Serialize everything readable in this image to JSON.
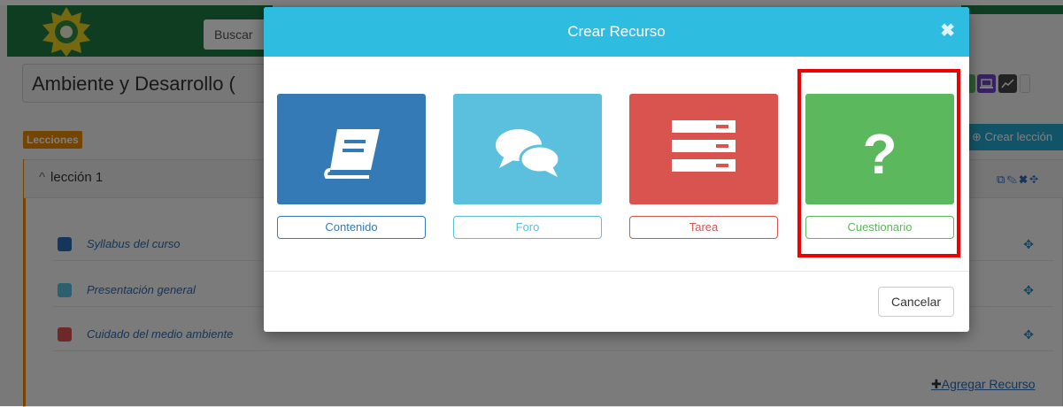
{
  "header": {
    "search_placeholder": "Buscar"
  },
  "course": {
    "title": "Ambiente y Desarrollo ("
  },
  "lessons": {
    "badge": "Lecciones",
    "create_label": "Crear lección",
    "lesson_title": "lección 1",
    "resources": [
      {
        "label": "Syllabus del curso",
        "icon": "book-icon",
        "color": "#2a6ab5"
      },
      {
        "label": "Presentación general",
        "icon": "chat-icon",
        "color": "#5bc0de"
      },
      {
        "label": "Cuidado del medio ambiente",
        "icon": "task-list-icon",
        "color": "#d9534f"
      }
    ],
    "add_resource": "Agregar Recurso"
  },
  "modal": {
    "title": "Crear Recurso",
    "options": [
      {
        "label": "Contenido",
        "icon": "book-icon",
        "color": "#337ab7"
      },
      {
        "label": "Foro",
        "icon": "chat-bubbles-icon",
        "color": "#5bc0de"
      },
      {
        "label": "Tarea",
        "icon": "task-list-icon",
        "color": "#d9534f"
      },
      {
        "label": "Cuestionario",
        "icon": "question-mark-icon",
        "color": "#5cb85c"
      }
    ],
    "cancel": "Cancelar"
  }
}
